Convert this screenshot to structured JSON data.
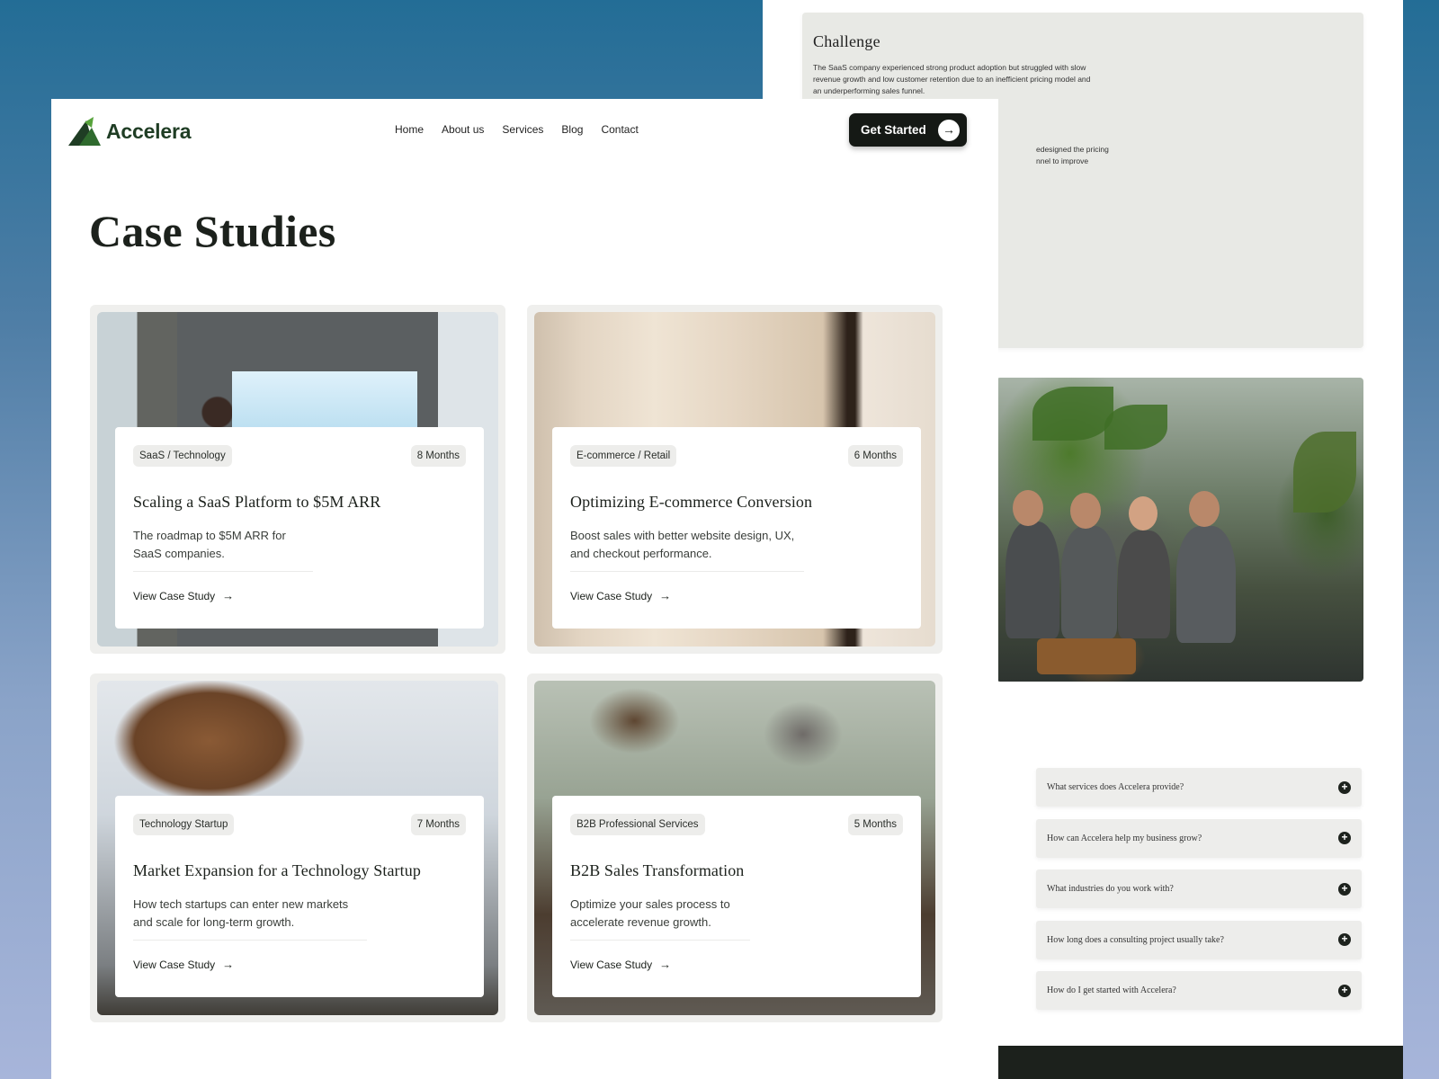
{
  "nav": {
    "brand": "Accelera",
    "links": [
      "Home",
      "About us",
      "Services",
      "Blog",
      "Contact"
    ],
    "cta_label": "Get Started",
    "cta_icon": "arrow-right-icon"
  },
  "page": {
    "title": "Case Studies"
  },
  "cards": [
    {
      "tag": "SaaS / Technology",
      "duration": "8 Months",
      "title": "Scaling a SaaS Platform to $5M ARR",
      "description": "The roadmap to $5M ARR for SaaS companies.",
      "link": "View Case Study"
    },
    {
      "tag": "E-commerce / Retail",
      "duration": "6 Months",
      "title": "Optimizing E-commerce Conversion",
      "description": "Boost sales with better website design, UX, and checkout performance.",
      "link": "View Case Study"
    },
    {
      "tag": "Technology Startup",
      "duration": "7 Months",
      "title": "Market Expansion for a Technology Startup",
      "description": "How tech startups can enter new markets and scale for long-term growth.",
      "link": "View Case Study"
    },
    {
      "tag": "B2B Professional Services",
      "duration": "5 Months",
      "title": "B2B Sales Transformation",
      "description": "Optimize your sales process to accelerate revenue growth.",
      "link": "View Case Study"
    }
  ],
  "background_page": {
    "challenge_title": "Challenge",
    "challenge_text": "The SaaS company experienced strong product adoption but struggled with slow revenue growth and low customer retention due to an inefficient pricing model and an underperforming sales funnel.",
    "partial_text": "edesigned the pricing nnel to improve",
    "faqs": [
      "What services does Accelera provide?",
      "How can Accelera help my business grow?",
      "What industries do you work with?",
      "How long does a consulting project usually take?",
      "How do I get started with Accelera?"
    ]
  },
  "colors": {
    "brand_dark": "#1c211c",
    "logo_green": "#1f3d24",
    "tag_bg": "#ededeb"
  }
}
